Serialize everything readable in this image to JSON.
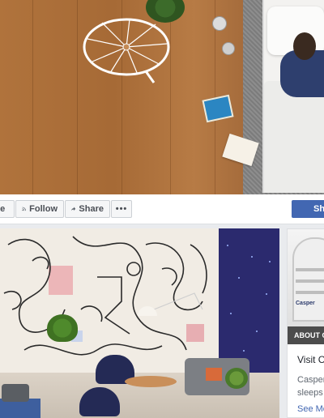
{
  "actions": {
    "like_label": "ke",
    "follow_label": "Follow",
    "share_label": "Share",
    "more_label": "•••",
    "primary_label": "Sh"
  },
  "card": {
    "badge": "ABOUT C",
    "logo_text": "Casper",
    "title": "Visit C",
    "description_line1": "Casper",
    "description_line2": "sleeps",
    "link": "See Mo"
  },
  "colors": {
    "primary": "#4267b2",
    "background": "#e9ebee",
    "navy_wall": "#2b2a6e"
  },
  "icons": {
    "follow": "rss-icon",
    "share": "share-arrow-icon",
    "more": "ellipsis-icon"
  }
}
